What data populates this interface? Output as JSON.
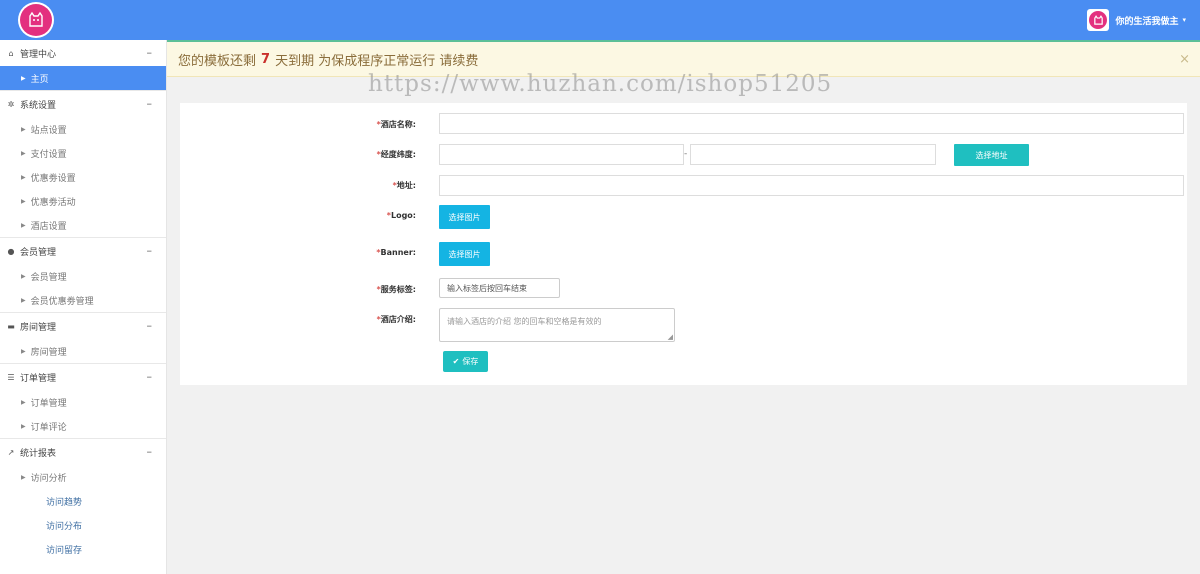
{
  "header": {
    "user_name": "你的生活我做主",
    "caret": "▾"
  },
  "sidebar": {
    "groups": [
      {
        "icon": "home-icon",
        "glyph": "⌂",
        "label": "管理中心",
        "collapse": "–",
        "items": [
          {
            "label": "主页",
            "active": true
          }
        ]
      },
      {
        "icon": "gear-icon",
        "glyph": "✲",
        "label": "系统设置",
        "collapse": "–",
        "items": [
          {
            "label": "站点设置"
          },
          {
            "label": "支付设置"
          },
          {
            "label": "优惠劵设置"
          },
          {
            "label": "优惠劵活动"
          },
          {
            "label": "酒店设置"
          }
        ]
      },
      {
        "icon": "user-icon",
        "glyph": "●",
        "label": "会员管理",
        "collapse": "–",
        "items": [
          {
            "label": "会员管理"
          },
          {
            "label": "会员优惠劵管理"
          }
        ]
      },
      {
        "icon": "bed-icon",
        "glyph": "▬",
        "label": "房间管理",
        "collapse": "–",
        "items": [
          {
            "label": "房间管理"
          }
        ]
      },
      {
        "icon": "list-icon",
        "glyph": "☰",
        "label": "订单管理",
        "collapse": "–",
        "items": [
          {
            "label": "订单管理"
          },
          {
            "label": "订单评论"
          }
        ]
      },
      {
        "icon": "line-chart-icon",
        "glyph": "↗",
        "label": "统计报表",
        "collapse": "–",
        "items": [
          {
            "label": "访问分析"
          }
        ],
        "subitems": [
          {
            "label": "访问趋势"
          },
          {
            "label": "访问分布"
          },
          {
            "label": "访问留存"
          }
        ]
      }
    ]
  },
  "alert": {
    "prefix": "您的模板还剩",
    "days": "7",
    "suffix": "天到期 为保成程序正常运行 请续费",
    "close": "×"
  },
  "watermark": "https://www.huzhan.com/ishop51205",
  "form": {
    "required_mark": "*",
    "hotel_name_label": "酒店名称:",
    "latlng_label": "经度纬度:",
    "latlng_sep": "-",
    "select_address_label": "选择地址",
    "address_label": "地址:",
    "logo_label": "Logo:",
    "banner_label": "Banner:",
    "select_image_label": "选择图片",
    "service_tags_label": "服务标签:",
    "service_tags_placeholder": "输入标签后按回车结束",
    "intro_label": "酒店介绍:",
    "intro_placeholder": "请输入酒店的介绍 您的回车和空格是有效的",
    "save_label": "保存"
  }
}
